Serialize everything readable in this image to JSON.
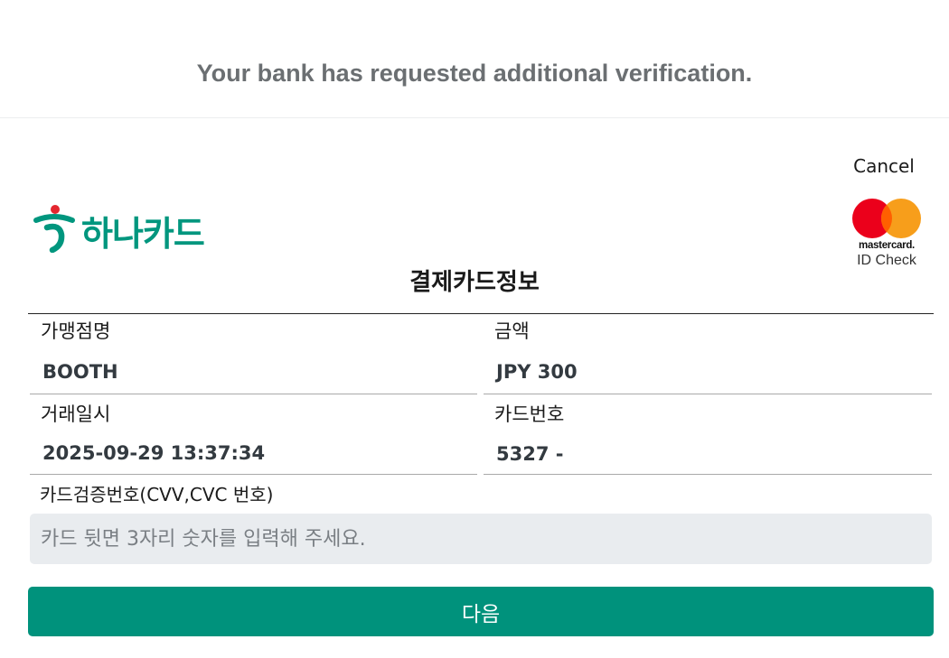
{
  "banner": {
    "text": "Your bank has requested additional verification."
  },
  "header": {
    "cancel_label": "Cancel",
    "logo_text": "하나카드",
    "logo_icon": "hana-card-logo-icon",
    "mastercard": {
      "wordmark": "mastercard.",
      "id_check": "ID Check",
      "colors": {
        "red": "#eb001b",
        "orange": "#f79e1b"
      }
    }
  },
  "title": "결제카드정보",
  "info": {
    "merchant": {
      "label": "가맹점명",
      "value": "BOOTH"
    },
    "amount": {
      "label": "금액",
      "value": "JPY 300"
    },
    "datetime": {
      "label": "거래일시",
      "value": "2025-09-29 13:37:34"
    },
    "card_number": {
      "label": "카드번호",
      "value": "5327 -"
    }
  },
  "cvv": {
    "label": "카드검증번호(CVV,CVC 번호)",
    "value": "",
    "placeholder": "카드 뒷면 3자리 숫자를 입력해 주세요."
  },
  "next_label": "다음",
  "colors": {
    "brand": "#00967e",
    "button": "#00927c",
    "input_bg": "#e9ecef"
  }
}
